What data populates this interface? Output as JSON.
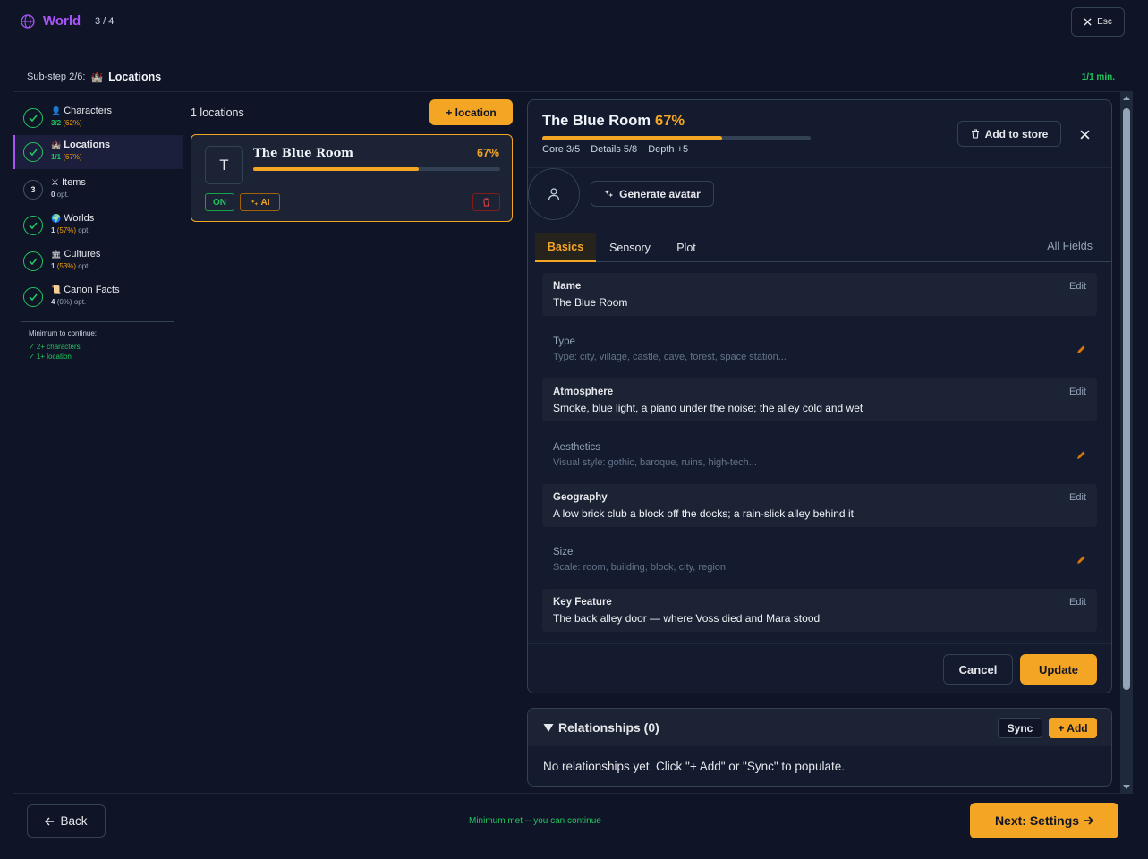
{
  "topbar": {
    "brand": "World",
    "step": "3 / 4",
    "esc_label": "Esc"
  },
  "substep": {
    "prefix": "Sub-step 2/6:",
    "icon": "🏰",
    "title": "Locations",
    "min_badge": "1/1 min."
  },
  "sidebar": {
    "items": [
      {
        "icon": "👤",
        "label": "Characters",
        "count": "3/2",
        "pct": "(62%)",
        "suffix": "",
        "status": "done"
      },
      {
        "icon": "🏰",
        "label": "Locations",
        "count": "1/1",
        "pct": "(67%)",
        "suffix": "",
        "status": "done"
      },
      {
        "icon": "⚔",
        "label": "Items",
        "count": "0",
        "pct": "",
        "suffix": "opt.",
        "status": "3"
      },
      {
        "icon": "🌍",
        "label": "Worlds",
        "count": "1",
        "pct": "(57%)",
        "suffix": "opt.",
        "status": "done"
      },
      {
        "icon": "🏛",
        "label": "Cultures",
        "count": "1",
        "pct": "(53%)",
        "suffix": "opt.",
        "status": "done"
      },
      {
        "icon": "📜",
        "label": "Canon Facts",
        "count": "4",
        "pct": "(0%)",
        "suffix": "opt.",
        "status": "done"
      }
    ],
    "minimum": {
      "title": "Minimum to continue:",
      "reqs": [
        "✓ 2+ characters",
        "✓ 1+ location"
      ]
    }
  },
  "list": {
    "count_label": "1 locations",
    "add_label": "+ location",
    "card": {
      "avatar_letter": "T",
      "name": "The Blue Room",
      "pct": "67%",
      "progress": 0.67,
      "on_label": "ON",
      "ai_label": "AI"
    }
  },
  "detail": {
    "title": "The Blue Room",
    "pct": "67%",
    "progress": 0.67,
    "stats": [
      "Core 3/5",
      "Details 5/8",
      "Depth +5"
    ],
    "store_label": "Add to store",
    "gen_avatar_label": "Generate avatar",
    "tabs": [
      "Basics",
      "Sensory",
      "Plot"
    ],
    "all_fields_label": "All Fields",
    "edit_label": "Edit",
    "fields": [
      {
        "label": "Name",
        "value": "The Blue Room",
        "filled": true
      },
      {
        "label": "Type",
        "value": "Type: city, village, castle, cave, forest, space station...",
        "filled": false
      },
      {
        "label": "Atmosphere",
        "value": "Smoke, blue light, a piano under the noise; the alley cold and wet",
        "filled": true
      },
      {
        "label": "Aesthetics",
        "value": "Visual style: gothic, baroque, ruins, high-tech...",
        "filled": false
      },
      {
        "label": "Geography",
        "value": "A low brick club a block off the docks; a rain-slick alley behind it",
        "filled": true
      },
      {
        "label": "Size",
        "value": "Scale: room, building, block, city, region",
        "filled": false
      },
      {
        "label": "Key Feature",
        "value": "The back alley door — where Voss died and Mara stood",
        "filled": true
      }
    ],
    "cancel_label": "Cancel",
    "update_label": "Update"
  },
  "relationships": {
    "title": "Relationships (0)",
    "sync_label": "Sync",
    "add_label": "+ Add",
    "empty_text": "No relationships yet. Click \"+ Add\" or \"Sync\" to populate."
  },
  "footer": {
    "back_label": "Back",
    "status": "Minimum met -- you can continue",
    "next_label": "Next: Settings"
  },
  "colors": {
    "accent": "#f5a524",
    "brand": "#a855f7",
    "success": "#22c55e",
    "background": "#0f1527"
  }
}
